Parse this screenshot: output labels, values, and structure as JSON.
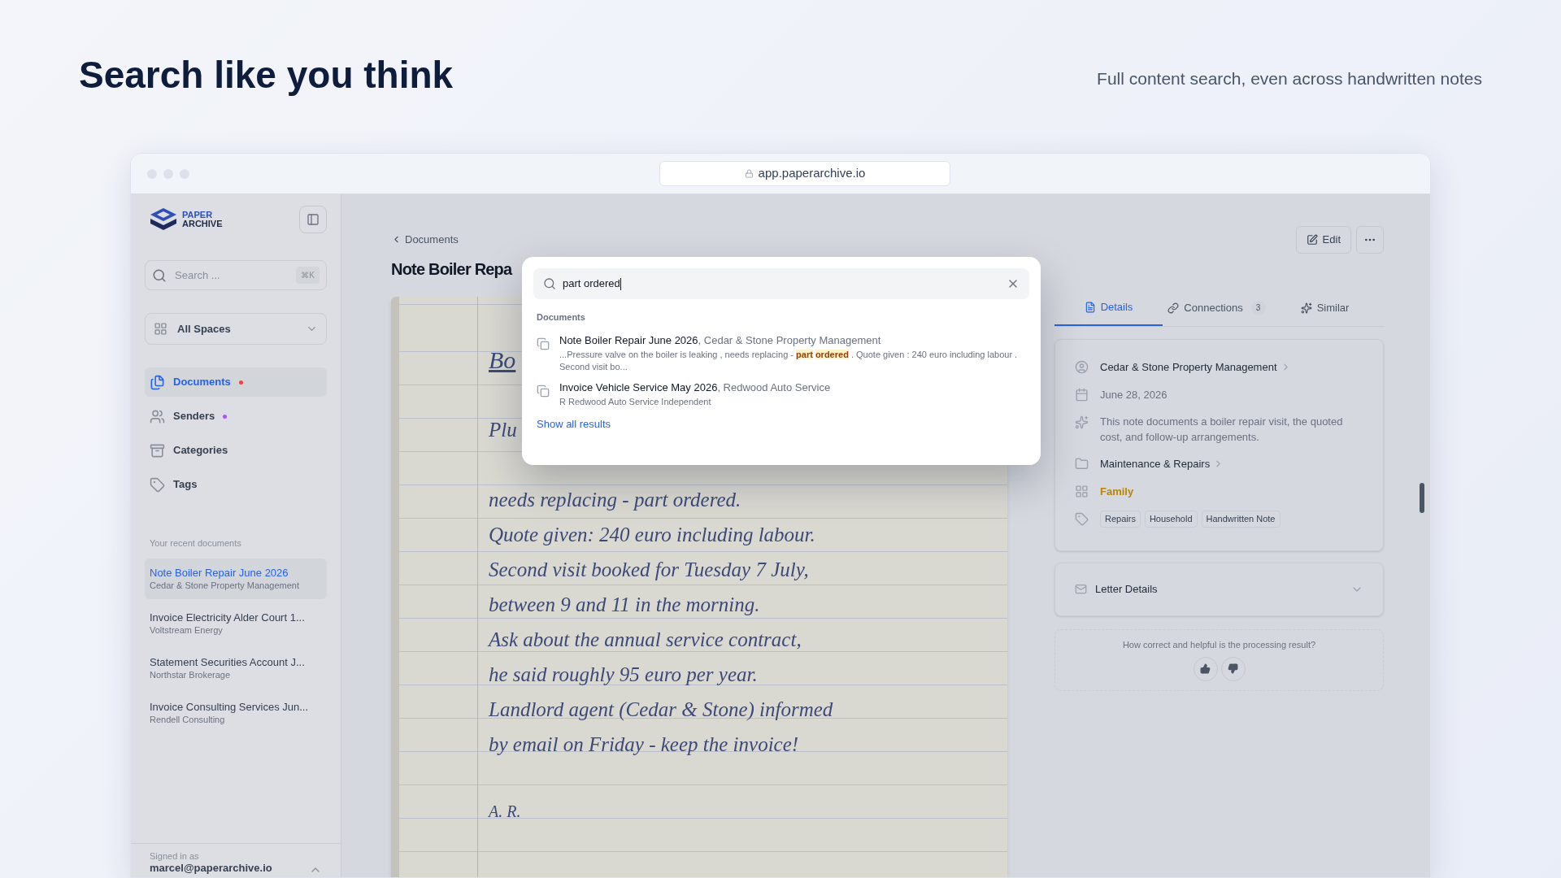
{
  "hero": {
    "title": "Search like you think",
    "subtitle": "Full content search, even across handwritten notes"
  },
  "browser": {
    "url": "app.paperarchive.io"
  },
  "sidebar": {
    "brand": [
      "PAPER",
      "ARCHIVE"
    ],
    "search": {
      "placeholder": "Search ...",
      "shortcut": "⌘K"
    },
    "space_selector": "All Spaces",
    "nav": [
      {
        "label": "Documents",
        "selected": true,
        "color": "#ef4444"
      },
      {
        "label": "Senders",
        "selected": false,
        "color": "#a855f7"
      },
      {
        "label": "Categories",
        "selected": false
      },
      {
        "label": "Tags",
        "selected": false
      }
    ],
    "recent_heading": "Your recent documents",
    "recent": [
      {
        "title": "Note Boiler Repair June 2026",
        "sender": "Cedar & Stone Property Management",
        "selected": true
      },
      {
        "title": "Invoice Electricity Alder Court 1...",
        "sender": "Voltstream Energy",
        "selected": false
      },
      {
        "title": "Statement Securities Account J...",
        "sender": "Northstar Brokerage",
        "selected": false
      },
      {
        "title": "Invoice Consulting Services Jun...",
        "sender": "Rendell Consulting",
        "selected": false
      }
    ],
    "footer": {
      "label": "Signed in as",
      "email": "marcel@paperarchive.io"
    }
  },
  "main": {
    "breadcrumb": "Documents",
    "title": "Note Boiler Repa",
    "note": {
      "heading": "Bo",
      "top_lines": [
        "Plu"
      ],
      "lines": [
        "needs replacing - part ordered.",
        "Quote given: 240 euro including labour.",
        "Second visit booked for Tuesday 7 July,",
        "between 9 and 11 in the morning.",
        "Ask about the annual service contract,",
        "he said roughly 95 euro per year.",
        "Landlord agent (Cedar & Stone) informed",
        "by email on Friday - keep the invoice!"
      ],
      "signature": "A. R."
    }
  },
  "search_popup": {
    "query": "part ordered",
    "section": "Documents",
    "results": [
      {
        "title": "**Note Boiler Repair June 2026**, Cedar & Stone Property Management",
        "snippet": "...Pressure valve on the boiler is leaking , needs replacing - **part** **ordered** . Quote given : 240 euro including labour . Second visit bo..."
      },
      {
        "title": "**Invoice Vehicle Service May 2026**, Redwood Auto Service",
        "snippet": "R Redwood Auto Service Independent"
      }
    ],
    "show_all": "Show all results"
  },
  "actions": {
    "edit": "Edit"
  },
  "details": {
    "tabs": [
      {
        "label": "Details",
        "selected": true
      },
      {
        "label": "Connections",
        "count": "3",
        "selected": false
      },
      {
        "label": "Similar",
        "selected": false
      }
    ],
    "sender": "Cedar & Stone Property Management",
    "date": "June 28, 2026",
    "summary": "This note documents a boiler repair visit, the quoted cost, and follow-up arrangements.",
    "category": "Maintenance & Repairs",
    "space": "Family",
    "tags": [
      "Repairs",
      "Household",
      "Handwritten Note"
    ],
    "letter_details": {
      "label": "Letter Details",
      "expanded": false
    },
    "feedback": {
      "question": "How correct and helpful is the processing result?"
    }
  }
}
